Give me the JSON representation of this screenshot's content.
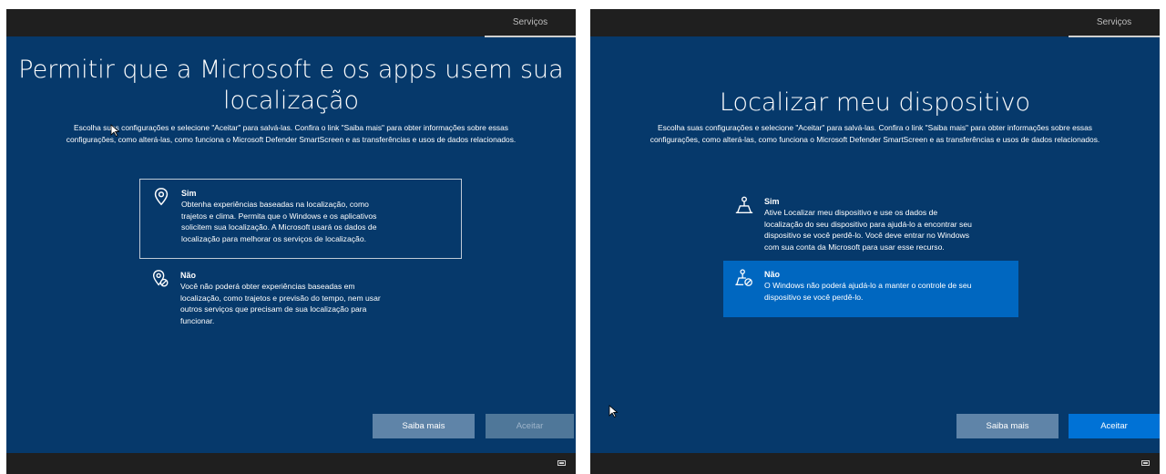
{
  "colors": {
    "screen_background": "#06396b",
    "top_bottom_bar": "#1f1f1f",
    "selected_option": "#0067c0",
    "primary_button": "#0072d6",
    "secondary_button": "#5f84a8"
  },
  "left_screen": {
    "services_tab": "Serviços",
    "title": "Permitir que a Microsoft e os apps usem sua localização",
    "description": {
      "line1": "Escolha suas configurações e selecione \"Aceitar\" para salvá-las. Confira o link \"Saiba mais\" para obter informações sobre essas",
      "line2": "configurações, como alterá-las, como funciona o Microsoft Defender SmartScreen e as transferências e usos de dados relacionados."
    },
    "option_yes": {
      "icon": "location-pin-icon",
      "title": "Sim",
      "desc": [
        "Obtenha experiências baseadas na localização, como",
        "trajetos e clima. Permita que o Windows e os aplicativos",
        "solicitem sua localização. A Microsoft usará os dados de",
        "localização para melhorar os serviços de localização."
      ]
    },
    "option_no": {
      "icon": "location-off-icon",
      "title": "Não",
      "desc": [
        "Você não poderá obter experiências baseadas em",
        "localização, como trajetos e previsão do tempo, nem usar",
        "outros serviços que precisam de sua localização para",
        "funcionar."
      ]
    },
    "learn_more_button": "Saiba mais",
    "accept_button": "Aceitar"
  },
  "right_screen": {
    "services_tab": "Serviços",
    "title": "Localizar meu dispositivo",
    "description": {
      "line1": "Escolha suas configurações e selecione \"Aceitar\" para salvá-las. Confira o link \"Saiba mais\" para obter informações sobre essas",
      "line2": "configurações, como alterá-las, como funciona o Microsoft Defender SmartScreen e as transferências e usos de dados relacionados."
    },
    "option_yes": {
      "icon": "find-device-icon",
      "title": "Sim",
      "desc": [
        "Ative Localizar meu dispositivo e use os dados de",
        "localização do seu dispositivo para ajudá-lo a encontrar seu",
        "dispositivo se você perdê-lo. Você deve entrar no Windows",
        "com sua conta da Microsoft para usar esse recurso."
      ]
    },
    "option_no": {
      "icon": "find-device-off-icon",
      "title": "Não",
      "desc": [
        "O Windows não poderá ajudá-lo a manter o controle de seu",
        "dispositivo se você perdê-lo."
      ]
    },
    "learn_more_button": "Saiba mais",
    "accept_button": "Aceitar"
  }
}
